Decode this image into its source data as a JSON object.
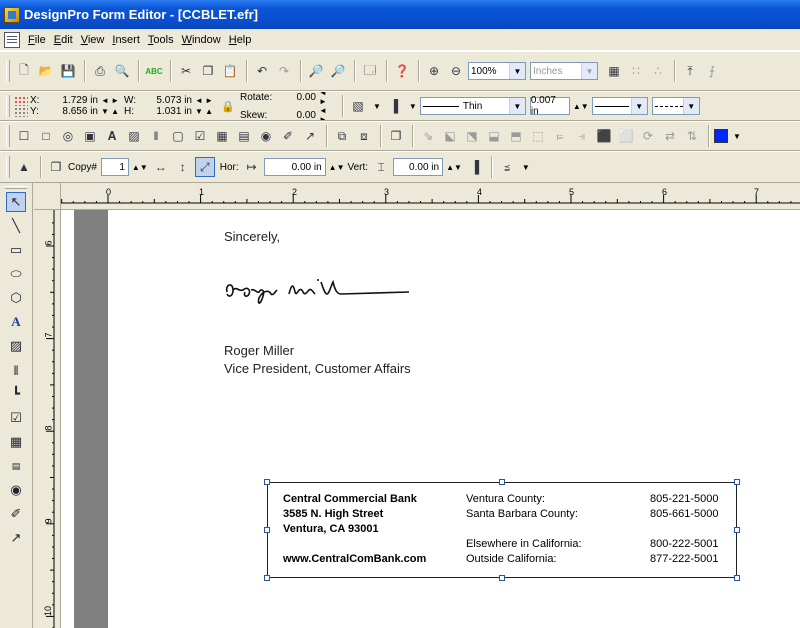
{
  "window": {
    "title": "DesignPro Form Editor - [CCBLET.efr]"
  },
  "menu": [
    {
      "key": "F",
      "rest": "ile"
    },
    {
      "key": "E",
      "rest": "dit"
    },
    {
      "key": "V",
      "rest": "iew"
    },
    {
      "key": "I",
      "rest": "nsert"
    },
    {
      "key": "T",
      "rest": "ools"
    },
    {
      "key": "W",
      "rest": "indow"
    },
    {
      "key": "H",
      "rest": "elp"
    }
  ],
  "toolbar": {
    "zoom_value": "100%",
    "units_value": "Inches",
    "abc_label": "ABC"
  },
  "position": {
    "x_label": "X:",
    "x_value": "1.729 in",
    "y_label": "Y:",
    "y_value": "8.656 in",
    "w_label": "W:",
    "w_value": "5.073 in",
    "h_label": "H:",
    "h_value": "1.031 in",
    "rotate_label": "Rotate:",
    "rotate_value": "0.00",
    "skew_label": "Skew:",
    "skew_value": "0.00",
    "line_style": "Thin",
    "line_width": "0.007 in"
  },
  "copy_bar": {
    "copy_label": "Copy#",
    "copy_value": "1",
    "hor_label": "Hor:",
    "hor_value": "0.00 in",
    "vert_label": "Vert:",
    "vert_value": "0.00 in"
  },
  "ruler": {
    "h_ticks": [
      "0",
      "1",
      "2",
      "3",
      "4",
      "5",
      "6",
      "7"
    ],
    "v_ticks": [
      "6",
      "7",
      "8",
      "9",
      "10"
    ]
  },
  "letter": {
    "closing": "Sincerely,",
    "name": "Roger Miller",
    "title": "Vice President, Customer Affairs"
  },
  "footer": {
    "bank_name": "Central Commercial Bank",
    "street": "3585 N. High Street",
    "city": "Ventura, CA 93001",
    "website": "www.CentralComBank.com",
    "contacts": [
      {
        "label": "Ventura County:",
        "phone": "805-221-5000"
      },
      {
        "label": "Santa Barbara County:",
        "phone": "805-661-5000"
      },
      {
        "label": "Elsewhere in California:",
        "phone": "800-222-5001"
      },
      {
        "label": "Outside California:",
        "phone": "877-222-5001"
      }
    ]
  }
}
